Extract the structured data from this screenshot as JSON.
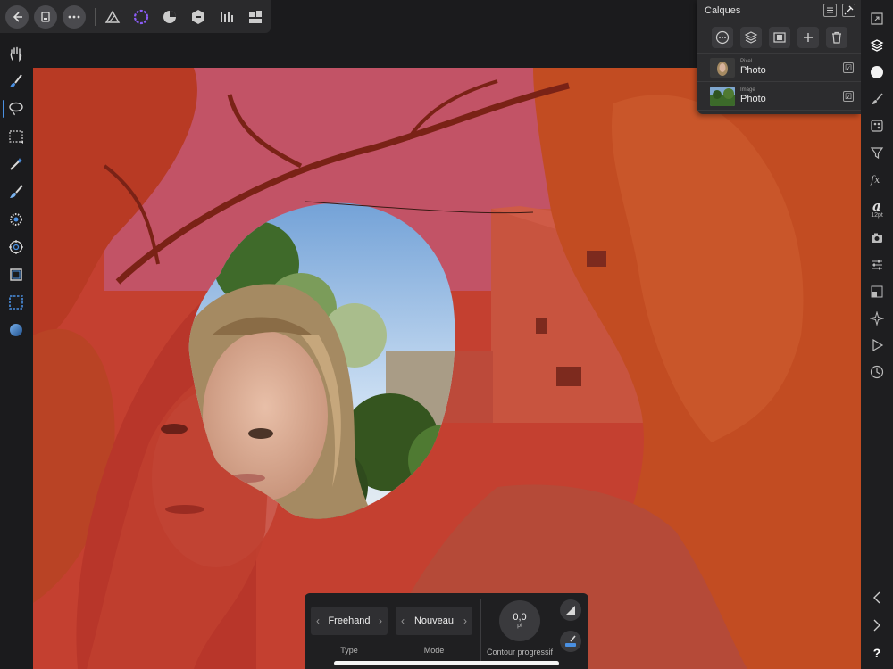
{
  "topbar": {
    "back_icon": "arrow-left-icon",
    "documents_icon": "documents-icon",
    "more_icon": "more-icon",
    "personas": [
      "photo-persona-icon",
      "liquify-persona-icon",
      "develop-persona-icon",
      "tone-mapping-persona-icon",
      "export-persona-icon"
    ]
  },
  "left_tools": [
    "hand-icon",
    "brush-selection-icon",
    "freehand-selection-icon",
    "rectangular-marquee-icon",
    "magic-wand-icon",
    "paint-brush-icon",
    "dodge-icon",
    "clone-icon",
    "crop-icon",
    "marquee-icon",
    "gradient-icon"
  ],
  "layers_panel": {
    "title": "Calques",
    "layers": [
      {
        "type": "Pixel",
        "name": "Photo",
        "checked": "☑"
      },
      {
        "type": "Image",
        "name": "Photo",
        "checked": "☑"
      }
    ]
  },
  "right_studio": {
    "character_label": "12pt",
    "icons": [
      "navigator-icon",
      "layers-icon",
      "colour-icon",
      "brushes-icon",
      "channels-icon",
      "filters-icon",
      "fx-icon",
      "character-icon",
      "stock-icon",
      "adjustments-icon",
      "transform-icon",
      "snapping-icon",
      "macros-icon",
      "history-icon",
      "chevron-left-icon",
      "chevron-right-icon",
      "help-icon"
    ]
  },
  "context_toolbar": {
    "type_value": "Freehand",
    "type_label": "Type",
    "mode_value": "Nouveau",
    "mode_label": "Mode",
    "feather_value": "0,0",
    "feather_unit": "pt",
    "feather_label": "Contour progressif",
    "help_symbol": "?"
  },
  "colors": {
    "accent": "#4a90e2",
    "mask_overlay": "#d83c2c",
    "panel_bg": "#2c2c2e"
  }
}
